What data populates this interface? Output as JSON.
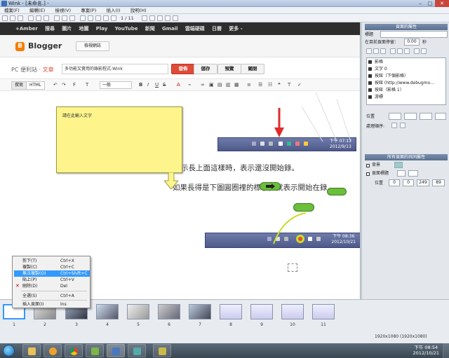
{
  "window": {
    "title": "Wink - [未命名.] -",
    "min": "–",
    "max": "□",
    "close": "✕"
  },
  "menu": [
    "檔案(F)",
    "編輯(E)",
    "檢視(V)",
    "專案(P)",
    "插入(I)",
    "說明(H)"
  ],
  "toolbar": {
    "frame_counter": "1 / 11"
  },
  "google_bar": [
    "+Amber",
    "搜尋",
    "圖片",
    "地圖",
    "Play",
    "YouTube",
    "新聞",
    "Gmail",
    "雲端硬碟",
    "日曆",
    "更多 -"
  ],
  "blogger": {
    "logo_letter": "B",
    "name": "Blogger",
    "view_blog": "檢視網誌",
    "blog_name": "PC 便利站",
    "section": "· 文章",
    "post_title": "多功能又實用的錄影程式-Wink",
    "publish": "發佈",
    "save": "儲存",
    "preview": "預覽",
    "close": "關閉",
    "mode_compose": "撰寫",
    "mode_html": "HTML",
    "font": "一般",
    "format_icons": [
      "↶",
      "↷",
      "F",
      "T",
      "B",
      "I",
      "U",
      "S",
      "A",
      "⌁",
      "∞",
      "▣",
      "▤",
      "▥",
      "▦",
      "≡",
      "☰",
      "☷",
      "❝",
      "T",
      "✓"
    ]
  },
  "content": {
    "line1": "示長上面這樣時，表示還沒開始錄。",
    "line2": "如果長得是下圖圓圈裡的標示，就表示開始在錄",
    "clock1_time": "下午 07:13",
    "clock1_date": "2012/9/13",
    "clock2_time": "下午 08:36",
    "clock2_date": "2012/10/21"
  },
  "note": {
    "text": "請在此輸入文字"
  },
  "context_menu": [
    {
      "label": "剪下(T)",
      "shortcut": "Ctrl+X"
    },
    {
      "label": "複製(C)",
      "shortcut": "Ctrl+C"
    },
    {
      "label": "無法複製(O)",
      "shortcut": "Ctrl+Shift+C"
    },
    {
      "label": "貼上(P)",
      "shortcut": "Ctrl+V"
    },
    {
      "label": "刪除(D)",
      "shortcut": "Del"
    },
    {
      "label": "全選(S)",
      "shortcut": "Ctrl+A"
    },
    {
      "label": "插入頁面(I)",
      "shortcut": "Ins"
    }
  ],
  "panel": {
    "frame_props_title": "頁面的屬性",
    "title_label": "標題",
    "delay_label": "在目前頁面停留：",
    "delay_value": "0.00",
    "delay_unit": "秒",
    "layers": [
      "影格",
      "文字 0",
      "按鈕（下個影格）",
      "按鈕 (http://www.debugmo...",
      "按鈕（影格 1）",
      "游標"
    ],
    "position_label": "位置",
    "order_label": "處理順序:",
    "project_title": "所有頁面的共同屬性",
    "bg_label": "背景",
    "title_bar_label": "頁面標題",
    "pos_label": "位置",
    "pos_values": [
      "0",
      "0",
      "249",
      "89"
    ]
  },
  "filmstrip": [
    "1",
    "2",
    "3",
    "4",
    "5",
    "6",
    "7",
    "8",
    "9",
    "10",
    "11"
  ],
  "status": {
    "resolution": "1920x1080 (1920x1080)"
  },
  "taskbar": {
    "time": "下午 08:54",
    "date": "2012/10/21"
  },
  "colors": {
    "accent": "#dd4b39",
    "blogger": "#f57d00",
    "highlight": "#3399ff",
    "note": "#fdf58b"
  }
}
